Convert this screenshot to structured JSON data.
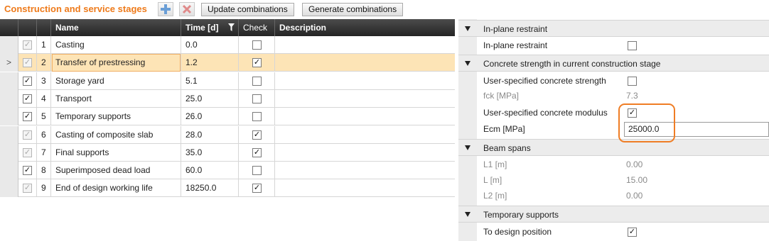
{
  "toolbar": {
    "title": "Construction and service stages",
    "add_icon": "add-stage-icon",
    "delete_icon": "delete-stage-icon",
    "update_label": "Update combinations",
    "generate_label": "Generate combinations"
  },
  "grid": {
    "columns": {
      "name": "Name",
      "time": "Time [d]",
      "check": "Check",
      "description": "Description"
    },
    "selected_row_marker": ">",
    "rows": [
      {
        "num": "1",
        "name": "Casting",
        "time": "0.0",
        "check": false,
        "enabled": false,
        "selected": false
      },
      {
        "num": "2",
        "name": "Transfer of prestressing",
        "time": "1.2",
        "check": true,
        "enabled": false,
        "selected": true
      },
      {
        "num": "3",
        "name": "Storage yard",
        "time": "5.1",
        "check": false,
        "enabled": true,
        "selected": false
      },
      {
        "num": "4",
        "name": "Transport",
        "time": "25.0",
        "check": false,
        "enabled": true,
        "selected": false
      },
      {
        "num": "5",
        "name": "Temporary supports",
        "time": "26.0",
        "check": false,
        "enabled": true,
        "selected": false
      },
      {
        "num": "6",
        "name": "Casting of composite slab",
        "time": "28.0",
        "check": true,
        "enabled": false,
        "selected": false
      },
      {
        "num": "7",
        "name": "Final supports",
        "time": "35.0",
        "check": true,
        "enabled": false,
        "selected": false
      },
      {
        "num": "8",
        "name": "Superimposed dead load",
        "time": "60.0",
        "check": false,
        "enabled": true,
        "selected": false
      },
      {
        "num": "9",
        "name": "End of design working life",
        "time": "18250.0",
        "check": true,
        "enabled": false,
        "selected": false
      }
    ]
  },
  "props": {
    "inplane": {
      "title": "In-plane restraint",
      "label": "In-plane restraint",
      "checked": false
    },
    "concrete": {
      "title": "Concrete strength in current construction stage",
      "user_strength_label": "User-specified concrete strength",
      "user_strength_checked": false,
      "fck_label": "fck [MPa]",
      "fck_value": "7.3",
      "user_modulus_label": "User-specified concrete modulus",
      "user_modulus_checked": true,
      "ecm_label": "Ecm [MPa]",
      "ecm_value": "25000.0"
    },
    "spans": {
      "title": "Beam spans",
      "l1_label": "L1 [m]",
      "l1_value": "0.00",
      "l_label": "L [m]",
      "l_value": "15.00",
      "l2_label": "L2 [m]",
      "l2_value": "0.00"
    },
    "temp": {
      "title": "Temporary supports",
      "label": "To design position",
      "checked": true
    }
  },
  "colors": {
    "accent": "#ee7a1a",
    "highlight": "#ef7d25",
    "selected_row": "#fde4b6",
    "header_bg": "#2f2f2f"
  }
}
